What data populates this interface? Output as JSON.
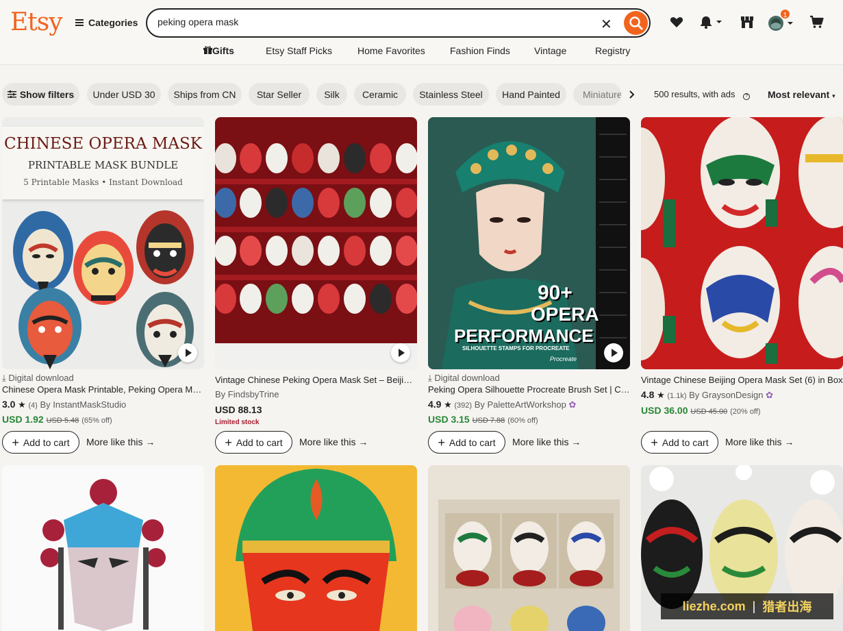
{
  "header": {
    "logo": "Etsy",
    "categories_label": "Categories",
    "search_value": "peking opera mask",
    "cart_badge": "1",
    "brand_color": "#f1641e"
  },
  "nav": {
    "gifts": "Gifts",
    "staff_picks": "Etsy Staff Picks",
    "home_favorites": "Home Favorites",
    "fashion_finds": "Fashion Finds",
    "vintage": "Vintage",
    "registry": "Registry"
  },
  "filters": {
    "show_filters": "Show filters",
    "chips": [
      "Under USD 30",
      "Ships from CN",
      "Star Seller",
      "Silk",
      "Ceramic",
      "Stainless Steel",
      "Hand Painted",
      "Miniature"
    ],
    "results": "500 results, with ads",
    "sort": "Most relevant"
  },
  "listings": [
    {
      "meta": "Digital download",
      "title": "Chinese Opera Mask Printable, Peking Opera Mask Bundle",
      "rating": "3.0",
      "reviews": "(4)",
      "shop": "By InstantMaskStudio",
      "price": "USD 1.92",
      "was": "USD 5.48",
      "off": "(65% off)",
      "image_text": {
        "line1": "CHINESE OPERA MASK",
        "line2": "PRINTABLE MASK BUNDLE",
        "line3": "5 Printable Masks • Instant Download"
      }
    },
    {
      "title": "Vintage Chinese Peking Opera Mask Set – Beijing Opera",
      "shop": "By FindsbyTrine",
      "price": "USD 88.13",
      "limited": "Limited stock"
    },
    {
      "meta": "Digital download",
      "title": "Peking Opera Silhouette Procreate Brush Set | Chinese",
      "rating": "4.9",
      "reviews": "(392)",
      "shop": "By PaletteArtWorkshop",
      "price": "USD 3.15",
      "was": "USD 7.88",
      "off": "(60% off)",
      "image_text": {
        "line1": "90+",
        "line2": "OPERA",
        "line3": "PERFORMANCE",
        "line4": "SILHOUETTE STAMPS FOR PROCREATE",
        "brand": "Procreate"
      }
    },
    {
      "title": "Vintage Chinese Beijing Opera Mask Set (6) in Box",
      "rating": "4.8",
      "reviews": "(1.1k)",
      "shop": "By GraysonDesign",
      "price": "USD 36.00",
      "was": "USD 45.00",
      "off": "(20% off)"
    }
  ],
  "actions": {
    "add_to_cart": "Add to cart",
    "more_like_this": "More like this"
  },
  "watermark": {
    "left": "liezhe.com",
    "right": "猎者出海"
  }
}
